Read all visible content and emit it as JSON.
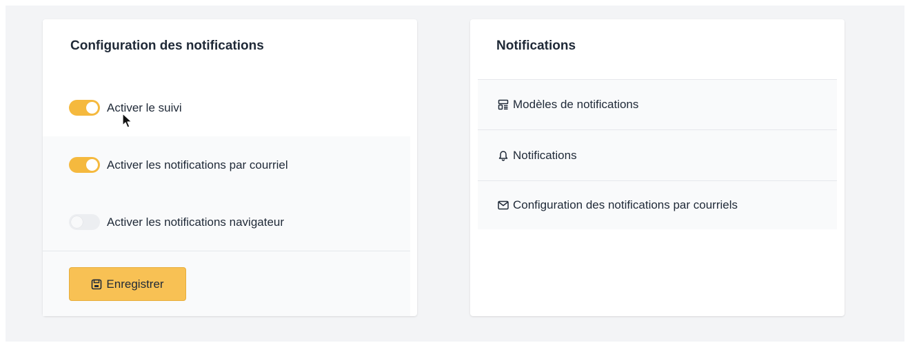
{
  "left_card": {
    "title": "Configuration des notifications",
    "settings": [
      {
        "label": "Activer le suivi",
        "enabled": true
      },
      {
        "label": "Activer les notifications par courriel",
        "enabled": true
      },
      {
        "label": "Activer les notifications navigateur",
        "enabled": false
      }
    ],
    "save_label": "Enregistrer"
  },
  "right_card": {
    "title": "Notifications",
    "links": [
      {
        "label": "Modèles de notifications",
        "icon": "template-icon"
      },
      {
        "label": "Notifications",
        "icon": "bell-icon"
      },
      {
        "label": "Configuration des notifications par courriels",
        "icon": "envelope-icon"
      }
    ]
  },
  "colors": {
    "accent": "#f5b93e",
    "button": "#f8c154",
    "background": "#f3f4f6"
  }
}
